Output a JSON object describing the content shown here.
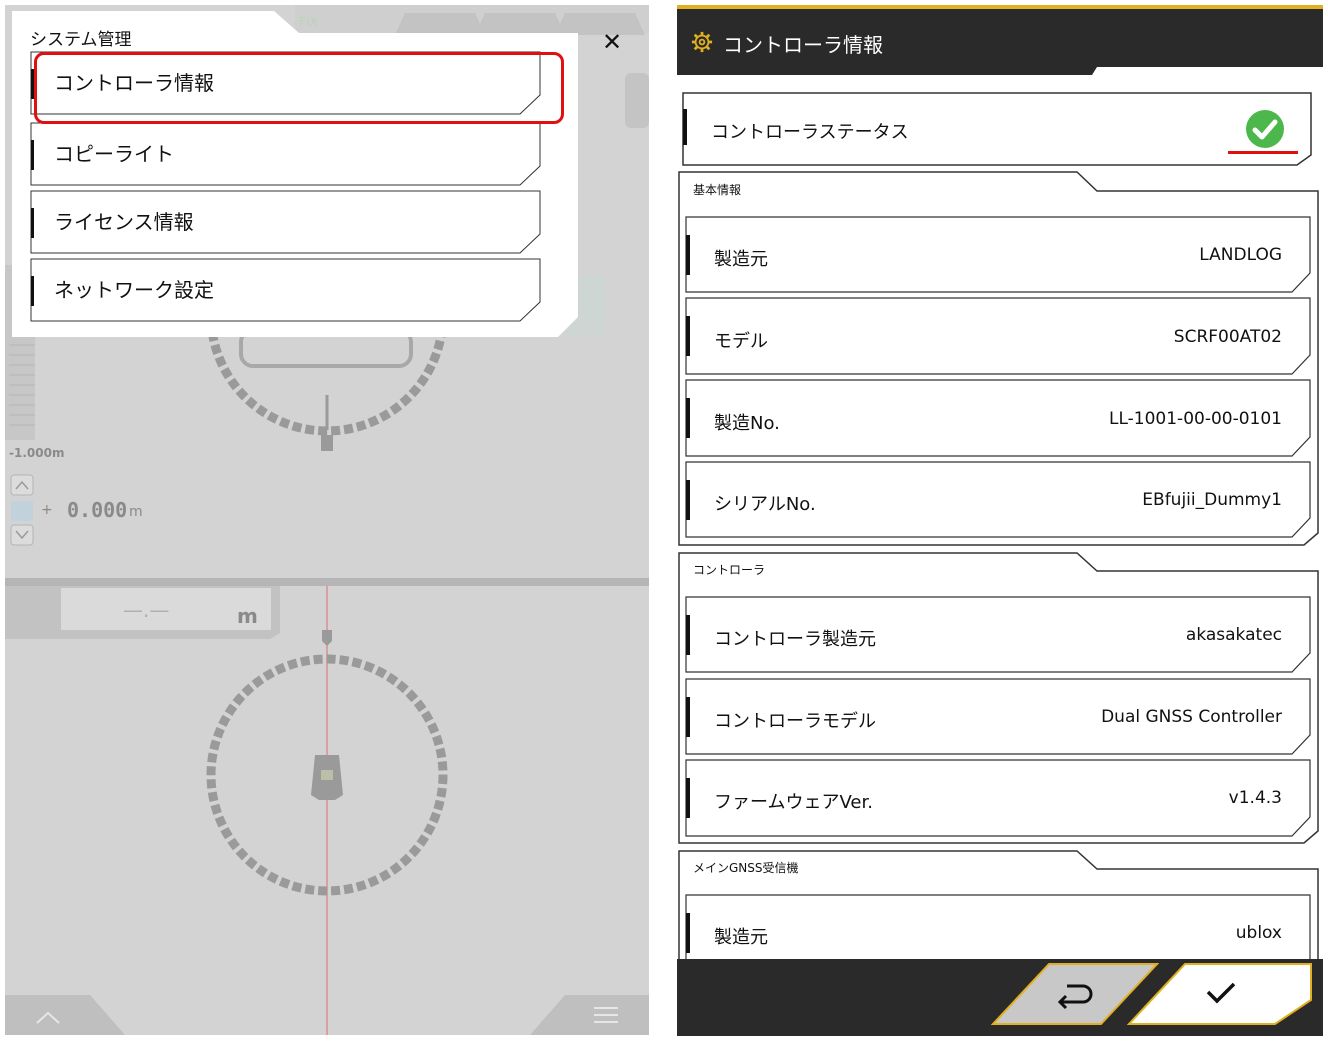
{
  "left_panel": {
    "menu": {
      "title": "システム管理",
      "close_symbol": "✕",
      "items": [
        {
          "label": "コントローラ情報",
          "highlighted": true
        },
        {
          "label": "コピーライト"
        },
        {
          "label": "ライセンス情報"
        },
        {
          "label": "ネットワーク設定"
        }
      ]
    },
    "background": {
      "fix_label": "FIX",
      "depth_label": "-1.000m",
      "offset_sign": "+",
      "offset_value": "0.000",
      "offset_unit": "m",
      "distance_value": "—.—",
      "distance_unit": "m"
    }
  },
  "right_panel": {
    "header": {
      "title": "コントローラ情報",
      "icon": "gear-icon"
    },
    "status": {
      "label": "コントローラステータス",
      "icon": "check-circle-icon",
      "status_color": "#4cb84c"
    },
    "sections": [
      {
        "title": "基本情報",
        "rows": [
          {
            "label": "製造元",
            "value": "LANDLOG"
          },
          {
            "label": "モデル",
            "value": "SCRF00AT02"
          },
          {
            "label": "製造No.",
            "value": "LL-1001-00-00-0101"
          },
          {
            "label": "シリアルNo.",
            "value": "EBfujii_Dummy1"
          }
        ]
      },
      {
        "title": "コントローラ",
        "rows": [
          {
            "label": "コントローラ製造元",
            "value": "akasakatec"
          },
          {
            "label": "コントローラモデル",
            "value": "Dual GNSS Controller"
          },
          {
            "label": "ファームウェアVer.",
            "value": "v1.4.3"
          }
        ]
      },
      {
        "title": "メインGNSS受信機",
        "rows": [
          {
            "label": "製造元",
            "value": "ublox"
          }
        ]
      }
    ],
    "footer": {
      "back_icon": "return-icon",
      "confirm_icon": "check-icon"
    },
    "colors": {
      "accent": "#e0b020",
      "dark": "#2a2a2a",
      "highlight": "#e01010"
    }
  }
}
